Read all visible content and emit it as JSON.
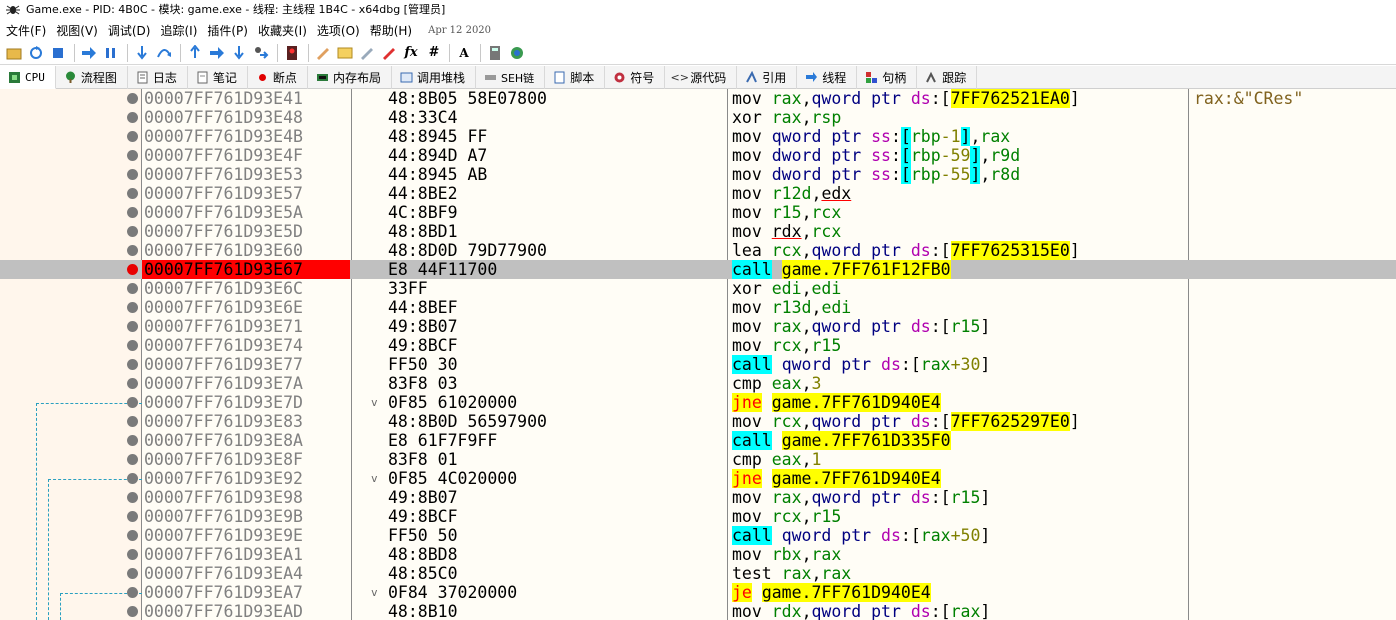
{
  "window": {
    "title": "Game.exe - PID: 4B0C - 模块: game.exe - 线程: 主线程 1B4C - x64dbg [管理员]"
  },
  "menu": {
    "items": [
      "文件(F)",
      "视图(V)",
      "调试(D)",
      "追踪(I)",
      "插件(P)",
      "收藏夹(I)",
      "选项(O)",
      "帮助(H)"
    ],
    "build_date": "Apr 12 2020"
  },
  "toolbar": {
    "icons": [
      "open-icon",
      "restart-icon",
      "stop-icon",
      "run-icon",
      "pause-icon",
      "step-into-icon",
      "step-over-icon",
      "trace-into-icon",
      "trace-over-icon",
      "execute-till-return-icon",
      "run-to-user-code-icon",
      "hide-debugger-icon",
      "comment-icon",
      "label-icon",
      "bookmark-icon",
      "function-icon",
      "patch-icon",
      "formula-icon",
      "hash-icon",
      "font-size-icon",
      "calculator-icon",
      "help-icon"
    ],
    "glyphs": {
      "formula": "fx",
      "hash": "#",
      "font": "A"
    }
  },
  "tabs": [
    {
      "label": "CPU",
      "icon": "cpu-icon",
      "active": true
    },
    {
      "label": "流程图",
      "icon": "graph-icon"
    },
    {
      "label": "日志",
      "icon": "log-icon"
    },
    {
      "label": "笔记",
      "icon": "notes-icon"
    },
    {
      "label": "断点",
      "icon": "breakpoint-icon"
    },
    {
      "label": "内存布局",
      "icon": "memory-map-icon"
    },
    {
      "label": "调用堆栈",
      "icon": "call-stack-icon"
    },
    {
      "label": "SEH链",
      "icon": "seh-chain-icon"
    },
    {
      "label": "脚本",
      "icon": "script-icon"
    },
    {
      "label": "符号",
      "icon": "symbols-icon"
    },
    {
      "label": "源代码",
      "icon": "source-icon"
    },
    {
      "label": "引用",
      "icon": "references-icon"
    },
    {
      "label": "线程",
      "icon": "threads-icon"
    },
    {
      "label": "句柄",
      "icon": "handles-icon"
    },
    {
      "label": "跟踪",
      "icon": "trace-icon"
    }
  ],
  "colors": {
    "breakpoint": "#ff0000",
    "selected_row": "#c0c0c0",
    "call_highlight": "#00ffff",
    "jump_highlight": "#ffff00",
    "address_text": "#808080"
  },
  "disassembly": [
    {
      "addr": "00007FF761D93E41",
      "bytes": "48:8B05 58E07800",
      "asm": [
        [
          "mn",
          "mov "
        ],
        [
          "rg",
          "rax"
        ],
        [
          "mn",
          ","
        ],
        [
          "sz",
          "qword ptr "
        ],
        [
          "sg",
          "ds"
        ],
        [
          "mn",
          ":["
        ],
        [
          "yl",
          "7FF762521EA0"
        ],
        [
          "mn",
          "]"
        ]
      ],
      "comment": "rax:&\"CRes\""
    },
    {
      "addr": "00007FF761D93E48",
      "bytes": "48:33C4",
      "asm": [
        [
          "mn",
          "xor "
        ],
        [
          "rg",
          "rax"
        ],
        [
          "mn",
          ","
        ],
        [
          "rg",
          "rsp"
        ]
      ]
    },
    {
      "addr": "00007FF761D93E4B",
      "bytes": "48:8945 FF",
      "asm": [
        [
          "mn",
          "mov "
        ],
        [
          "sz",
          "qword ptr "
        ],
        [
          "sg",
          "ss"
        ],
        [
          "mn",
          ":"
        ],
        [
          "cy",
          "["
        ],
        [
          "rg",
          "rbp"
        ],
        [
          "nm",
          "-1"
        ],
        [
          "cy",
          "]"
        ],
        [
          "mn",
          ","
        ],
        [
          "rg",
          "rax"
        ]
      ]
    },
    {
      "addr": "00007FF761D93E4F",
      "bytes": "44:894D A7",
      "asm": [
        [
          "mn",
          "mov "
        ],
        [
          "sz",
          "dword ptr "
        ],
        [
          "sg",
          "ss"
        ],
        [
          "mn",
          ":"
        ],
        [
          "cy",
          "["
        ],
        [
          "rg",
          "rbp"
        ],
        [
          "nm",
          "-59"
        ],
        [
          "cy",
          "]"
        ],
        [
          "mn",
          ","
        ],
        [
          "rg",
          "r9d"
        ]
      ]
    },
    {
      "addr": "00007FF761D93E53",
      "bytes": "44:8945 AB",
      "asm": [
        [
          "mn",
          "mov "
        ],
        [
          "sz",
          "dword ptr "
        ],
        [
          "sg",
          "ss"
        ],
        [
          "mn",
          ":"
        ],
        [
          "cy",
          "["
        ],
        [
          "rg",
          "rbp"
        ],
        [
          "nm",
          "-55"
        ],
        [
          "cy",
          "]"
        ],
        [
          "mn",
          ","
        ],
        [
          "rg",
          "r8d"
        ]
      ]
    },
    {
      "addr": "00007FF761D93E57",
      "bytes": "44:8BE2",
      "asm": [
        [
          "mn",
          "mov "
        ],
        [
          "rg",
          "r12d"
        ],
        [
          "mn",
          ","
        ],
        [
          "ul",
          "edx"
        ]
      ]
    },
    {
      "addr": "00007FF761D93E5A",
      "bytes": "4C:8BF9",
      "asm": [
        [
          "mn",
          "mov "
        ],
        [
          "rg",
          "r15"
        ],
        [
          "mn",
          ","
        ],
        [
          "rg",
          "rcx"
        ]
      ]
    },
    {
      "addr": "00007FF761D93E5D",
      "bytes": "48:8BD1",
      "asm": [
        [
          "mn",
          "mov "
        ],
        [
          "ul",
          "rdx"
        ],
        [
          "mn",
          ","
        ],
        [
          "rg",
          "rcx"
        ]
      ]
    },
    {
      "addr": "00007FF761D93E60",
      "bytes": "48:8D0D 79D77900",
      "asm": [
        [
          "mn",
          "lea "
        ],
        [
          "rg",
          "rcx"
        ],
        [
          "mn",
          ","
        ],
        [
          "sz",
          "qword ptr "
        ],
        [
          "sg",
          "ds"
        ],
        [
          "mn",
          ":["
        ],
        [
          "yl",
          "7FF7625315E0"
        ],
        [
          "mn",
          "]"
        ]
      ]
    },
    {
      "addr": "00007FF761D93E67",
      "bytes": "E8 44F11700",
      "asm": [
        [
          "cl",
          "call"
        ],
        [
          "mn",
          " "
        ],
        [
          "yl",
          "game.7FF761F12FB0"
        ]
      ],
      "bp": true,
      "sel": true
    },
    {
      "addr": "00007FF761D93E6C",
      "bytes": "33FF",
      "asm": [
        [
          "mn",
          "xor "
        ],
        [
          "rg",
          "edi"
        ],
        [
          "mn",
          ","
        ],
        [
          "rg",
          "edi"
        ]
      ]
    },
    {
      "addr": "00007FF761D93E6E",
      "bytes": "44:8BEF",
      "asm": [
        [
          "mn",
          "mov "
        ],
        [
          "rg",
          "r13d"
        ],
        [
          "mn",
          ","
        ],
        [
          "rg",
          "edi"
        ]
      ]
    },
    {
      "addr": "00007FF761D93E71",
      "bytes": "49:8B07",
      "asm": [
        [
          "mn",
          "mov "
        ],
        [
          "rg",
          "rax"
        ],
        [
          "mn",
          ","
        ],
        [
          "sz",
          "qword ptr "
        ],
        [
          "sg",
          "ds"
        ],
        [
          "mn",
          ":["
        ],
        [
          "rg",
          "r15"
        ],
        [
          "mn",
          "]"
        ]
      ]
    },
    {
      "addr": "00007FF761D93E74",
      "bytes": "49:8BCF",
      "asm": [
        [
          "mn",
          "mov "
        ],
        [
          "rg",
          "rcx"
        ],
        [
          "mn",
          ","
        ],
        [
          "rg",
          "r15"
        ]
      ]
    },
    {
      "addr": "00007FF761D93E77",
      "bytes": "FF50 30",
      "asm": [
        [
          "cl",
          "call"
        ],
        [
          "mn",
          " "
        ],
        [
          "sz",
          "qword ptr "
        ],
        [
          "sg",
          "ds"
        ],
        [
          "mn",
          ":["
        ],
        [
          "rg",
          "rax"
        ],
        [
          "nm",
          "+30"
        ],
        [
          "mn",
          "]"
        ]
      ]
    },
    {
      "addr": "00007FF761D93E7A",
      "bytes": "83F8 03",
      "asm": [
        [
          "mn",
          "cmp "
        ],
        [
          "rg",
          "eax"
        ],
        [
          "mn",
          ","
        ],
        [
          "nm",
          "3"
        ]
      ]
    },
    {
      "addr": "00007FF761D93E7D",
      "bytes": "0F85 61020000",
      "arrow": "v",
      "asm": [
        [
          "jn",
          "jne"
        ],
        [
          "mn",
          " "
        ],
        [
          "yl",
          "game.7FF761D940E4"
        ]
      ]
    },
    {
      "addr": "00007FF761D93E83",
      "bytes": "48:8B0D 56597900",
      "asm": [
        [
          "mn",
          "mov "
        ],
        [
          "rg",
          "rcx"
        ],
        [
          "mn",
          ","
        ],
        [
          "sz",
          "qword ptr "
        ],
        [
          "sg",
          "ds"
        ],
        [
          "mn",
          ":["
        ],
        [
          "yl",
          "7FF7625297E0"
        ],
        [
          "mn",
          "]"
        ]
      ]
    },
    {
      "addr": "00007FF761D93E8A",
      "bytes": "E8 61F7F9FF",
      "asm": [
        [
          "cl",
          "call"
        ],
        [
          "mn",
          " "
        ],
        [
          "yl",
          "game.7FF761D335F0"
        ]
      ]
    },
    {
      "addr": "00007FF761D93E8F",
      "bytes": "83F8 01",
      "asm": [
        [
          "mn",
          "cmp "
        ],
        [
          "rg",
          "eax"
        ],
        [
          "mn",
          ","
        ],
        [
          "nm",
          "1"
        ]
      ]
    },
    {
      "addr": "00007FF761D93E92",
      "bytes": "0F85 4C020000",
      "arrow": "v",
      "asm": [
        [
          "jn",
          "jne"
        ],
        [
          "mn",
          " "
        ],
        [
          "yl",
          "game.7FF761D940E4"
        ]
      ]
    },
    {
      "addr": "00007FF761D93E98",
      "bytes": "49:8B07",
      "asm": [
        [
          "mn",
          "mov "
        ],
        [
          "rg",
          "rax"
        ],
        [
          "mn",
          ","
        ],
        [
          "sz",
          "qword ptr "
        ],
        [
          "sg",
          "ds"
        ],
        [
          "mn",
          ":["
        ],
        [
          "rg",
          "r15"
        ],
        [
          "mn",
          "]"
        ]
      ]
    },
    {
      "addr": "00007FF761D93E9B",
      "bytes": "49:8BCF",
      "asm": [
        [
          "mn",
          "mov "
        ],
        [
          "rg",
          "rcx"
        ],
        [
          "mn",
          ","
        ],
        [
          "rg",
          "r15"
        ]
      ]
    },
    {
      "addr": "00007FF761D93E9E",
      "bytes": "FF50 50",
      "asm": [
        [
          "cl",
          "call"
        ],
        [
          "mn",
          " "
        ],
        [
          "sz",
          "qword ptr "
        ],
        [
          "sg",
          "ds"
        ],
        [
          "mn",
          ":["
        ],
        [
          "rg",
          "rax"
        ],
        [
          "nm",
          "+50"
        ],
        [
          "mn",
          "]"
        ]
      ]
    },
    {
      "addr": "00007FF761D93EA1",
      "bytes": "48:8BD8",
      "asm": [
        [
          "mn",
          "mov "
        ],
        [
          "rg",
          "rbx"
        ],
        [
          "mn",
          ","
        ],
        [
          "rg",
          "rax"
        ]
      ]
    },
    {
      "addr": "00007FF761D93EA4",
      "bytes": "48:85C0",
      "asm": [
        [
          "mn",
          "test "
        ],
        [
          "rg",
          "rax"
        ],
        [
          "mn",
          ","
        ],
        [
          "rg",
          "rax"
        ]
      ]
    },
    {
      "addr": "00007FF761D93EA7",
      "bytes": "0F84 37020000",
      "arrow": "v",
      "asm": [
        [
          "jn",
          "je"
        ],
        [
          "mn",
          " "
        ],
        [
          "yl",
          "game.7FF761D940E4"
        ]
      ]
    },
    {
      "addr": "00007FF761D93EAD",
      "bytes": "48:8B10",
      "asm": [
        [
          "mn",
          "mov "
        ],
        [
          "rg",
          "rdx"
        ],
        [
          "mn",
          ","
        ],
        [
          "sz",
          "qword ptr "
        ],
        [
          "sg",
          "ds"
        ],
        [
          "mn",
          ":["
        ],
        [
          "rg",
          "rax"
        ],
        [
          "mn",
          "]"
        ]
      ]
    }
  ]
}
